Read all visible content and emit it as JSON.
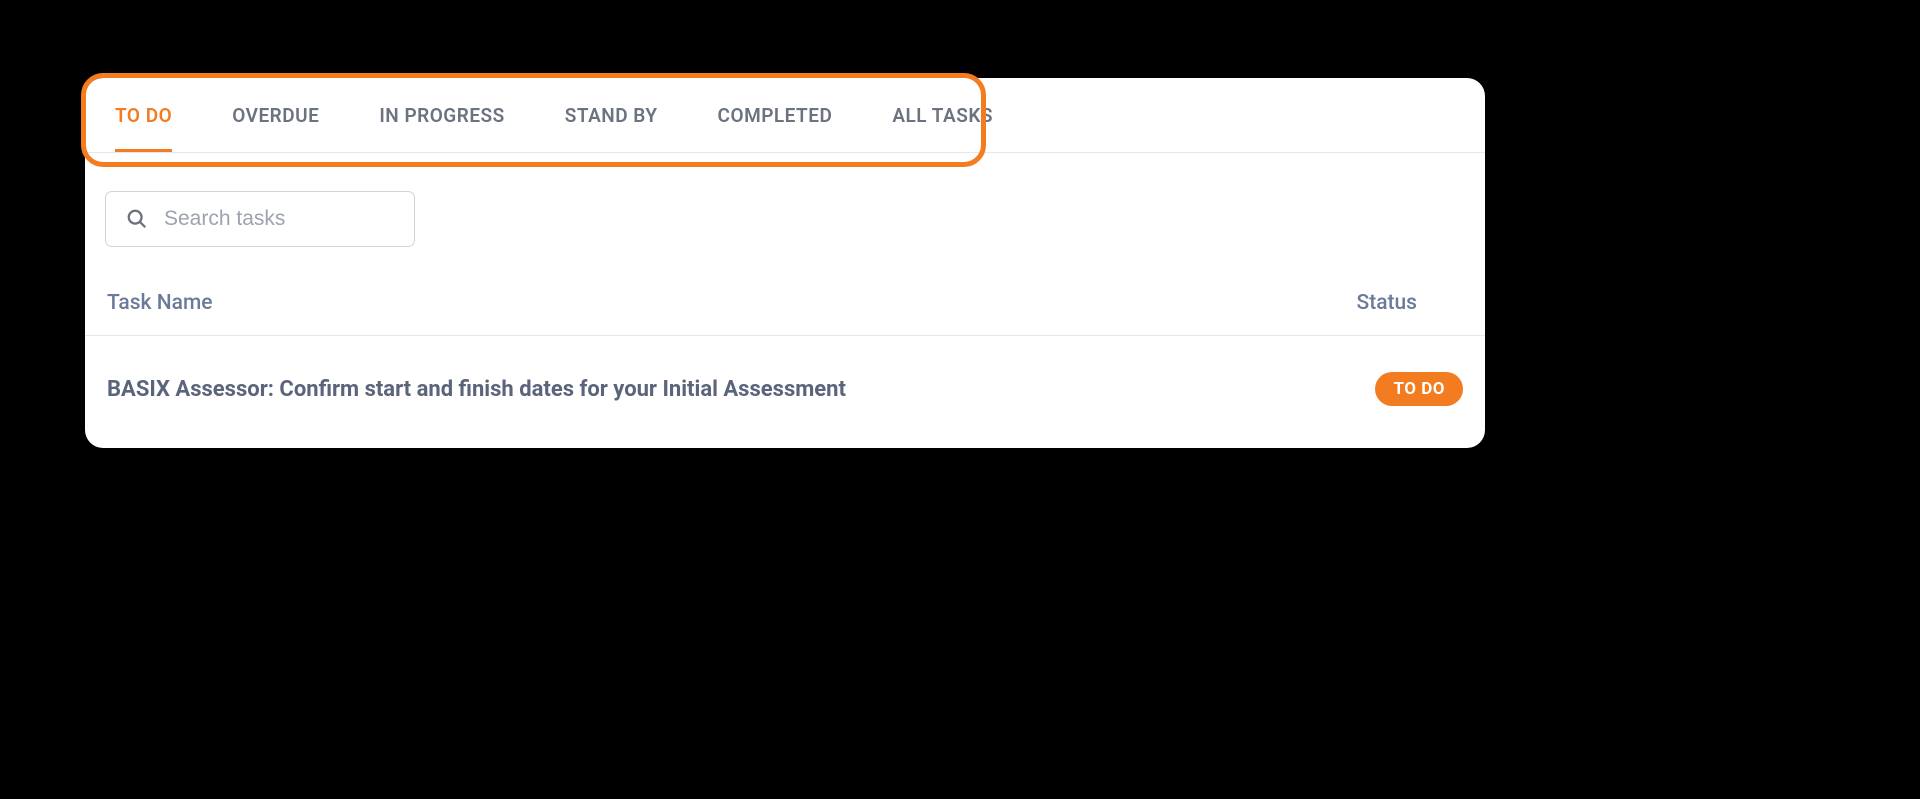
{
  "tabs": {
    "0": {
      "label": "TO DO"
    },
    "1": {
      "label": "OVERDUE"
    },
    "2": {
      "label": "IN PROGRESS"
    },
    "3": {
      "label": "STAND BY"
    },
    "4": {
      "label": "COMPLETED"
    },
    "5": {
      "label": "ALL TASKS"
    }
  },
  "search": {
    "placeholder": "Search tasks"
  },
  "table": {
    "headers": {
      "name": "Task Name",
      "status": "Status"
    },
    "rows": {
      "0": {
        "name": "BASIX Assessor: Confirm start and finish dates for your Initial Assessment",
        "status": "TO DO"
      }
    }
  }
}
